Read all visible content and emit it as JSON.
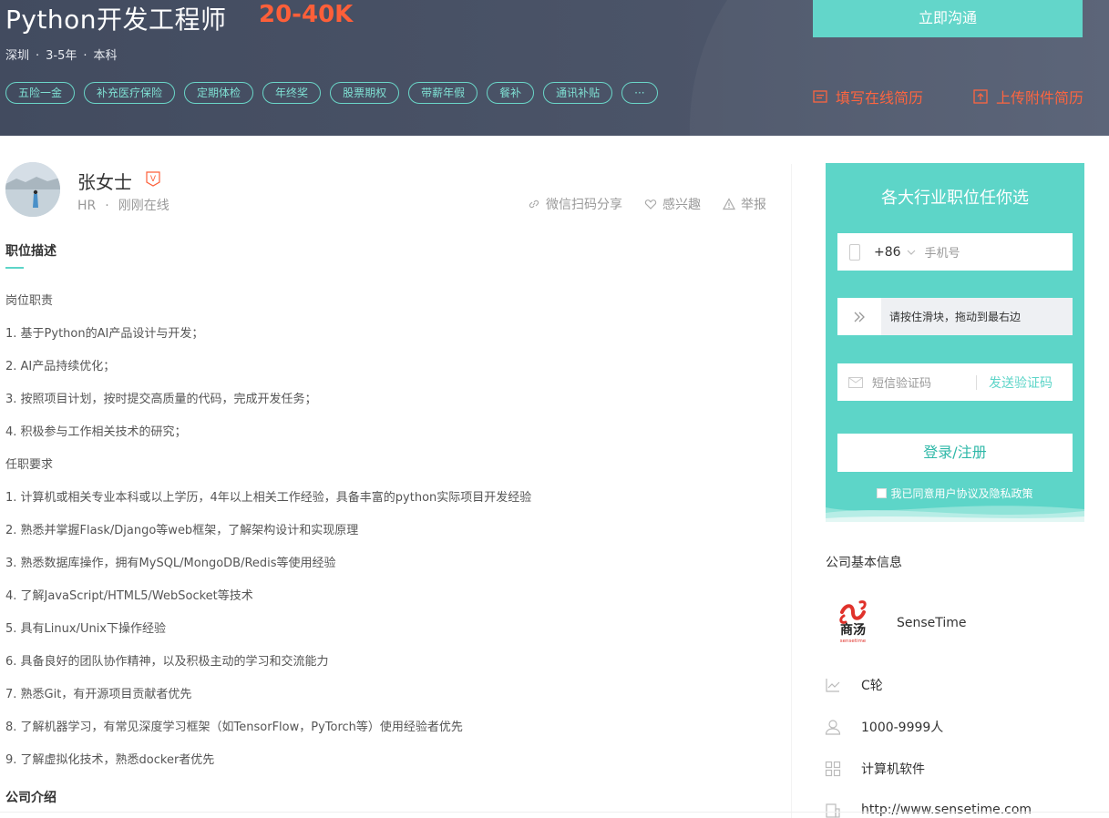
{
  "job": {
    "title": "Python开发工程师",
    "salary": "20-40K",
    "city": "深圳",
    "experience": "3-5年",
    "education": "本科",
    "tags": [
      "五险一金",
      "补充医疗保险",
      "定期体检",
      "年终奖",
      "股票期权",
      "带薪年假",
      "餐补",
      "通讯补贴",
      "···"
    ],
    "chat_button": "立即沟通",
    "fill_resume": "填写在线简历",
    "upload_resume": "上传附件简历"
  },
  "hr": {
    "name": "张女士",
    "badge": "V",
    "role": "HR",
    "status": "刚刚在线",
    "share": "微信扫码分享",
    "interest": "感兴趣",
    "report": "举报"
  },
  "description": {
    "title": "职位描述",
    "duties_heading": "岗位职责",
    "duties": [
      "1. 基于Python的AI产品设计与开发；",
      "2. AI产品持续优化；",
      "3. 按照项目计划，按时提交高质量的代码，完成开发任务；",
      "4. 积极参与工作相关技术的研究；"
    ],
    "req_heading": "任职要求",
    "requirements": [
      "1. 计算机或相关专业本科或以上学历，4年以上相关工作经验，具备丰富的python实际项目开发经验",
      "2. 熟悉并掌握Flask/Django等web框架，了解架构设计和实现原理",
      "3. 熟悉数据库操作，拥有MySQL/MongoDB/Redis等使用经验",
      "4. 了解JavaScript/HTML5/WebSocket等技术",
      "5. 具有Linux/Unix下操作经验",
      "6. 具备良好的团队协作精神，以及积极主动的学习和交流能力",
      "7. 熟悉Git，有开源项目贡献者优先",
      "8. 了解机器学习，有常见深度学习框架（如TensorFlow，PyTorch等）使用经验者优先",
      "9. 了解虚拟化技术，熟悉docker者优先"
    ],
    "company_intro_title": "公司介绍"
  },
  "register": {
    "title": "各大行业职位任你选",
    "country_code": "+86",
    "phone_placeholder": "手机号",
    "slider_hint": "请按住滑块，拖动到最右边",
    "sms_placeholder": "短信验证码",
    "send_code": "发送验证码",
    "login_button": "登录/注册",
    "agree_text": "我已同意用户协议及隐私政策"
  },
  "company": {
    "section_title": "公司基本信息",
    "logo_text": "商汤",
    "logo_subtext": "sensetime",
    "name": "SenseTime",
    "stage": "C轮",
    "size": "1000-9999人",
    "industry": "计算机软件",
    "website": "http://www.sensetime.com"
  },
  "colors": {
    "accent": "#5dd5c8",
    "salary": "#fd5f39",
    "header_bg": "#464f63"
  }
}
